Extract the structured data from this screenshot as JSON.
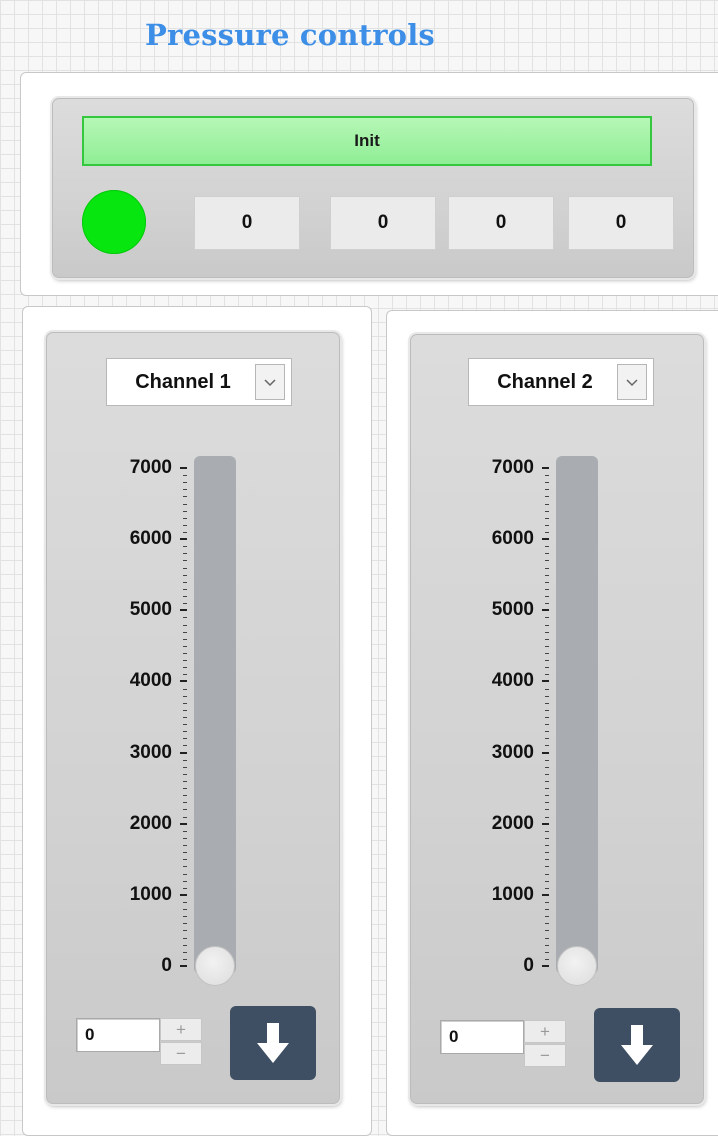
{
  "title": "Pressure controls",
  "init_panel": {
    "init_label": "Init",
    "led_color": "#07e60f",
    "readouts": [
      "0",
      "0",
      "0",
      "0"
    ]
  },
  "channels": [
    {
      "selected": "Channel 1",
      "scale_labels": [
        "7000",
        "6000",
        "5000",
        "4000",
        "3000",
        "2000",
        "1000",
        "0"
      ],
      "slider_value": 0,
      "slider_max": 7000,
      "numeric_value": "0",
      "stepper_up": "+",
      "stepper_down": "−"
    },
    {
      "selected": "Channel 2",
      "scale_labels": [
        "7000",
        "6000",
        "5000",
        "4000",
        "3000",
        "2000",
        "1000",
        "0"
      ],
      "slider_value": 0,
      "slider_max": 7000,
      "numeric_value": "0",
      "stepper_up": "+",
      "stepper_down": "−"
    }
  ],
  "colors": {
    "title": "#3d8ee6",
    "init_fill": "#b6f7b6",
    "init_border": "#35c83f",
    "button_dark": "#3f4f63",
    "slider_track": "#a9adb1"
  },
  "icons": {
    "dropdown": "chevron-down-icon",
    "send": "arrow-down-icon"
  }
}
